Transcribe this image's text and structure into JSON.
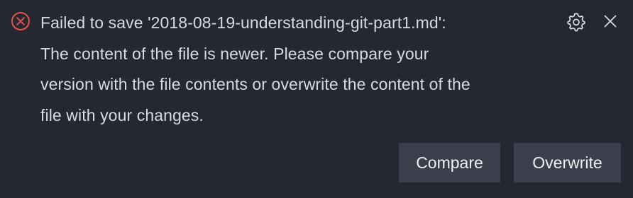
{
  "notification": {
    "severity": "error",
    "message": "Failed to save '2018-08-19-understanding-git-part1.md':\nThe content of the file is newer. Please compare your\nversion with the file contents or overwrite the content of the\nfile with your changes.",
    "icons": {
      "status": "error-circle-icon",
      "settings": "gear-icon",
      "close": "close-icon"
    },
    "actions": {
      "compare_label": "Compare",
      "overwrite_label": "Overwrite"
    }
  },
  "colors": {
    "background": "#252830",
    "error": "#e5534b",
    "text": "#d8dae0",
    "button_background": "#3a3f4b"
  }
}
